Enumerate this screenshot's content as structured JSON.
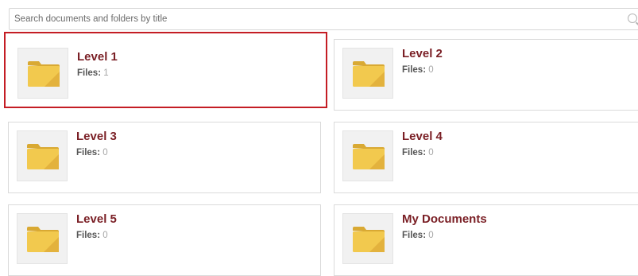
{
  "search": {
    "placeholder": "Search documents and folders by title"
  },
  "folders": [
    {
      "title": "Level 1",
      "files_label": "Files:",
      "files_count": "1",
      "selected": true
    },
    {
      "title": "Level 2",
      "files_label": "Files:",
      "files_count": "0",
      "selected": false
    },
    {
      "title": "Level 3",
      "files_label": "Files:",
      "files_count": "0",
      "selected": false
    },
    {
      "title": "Level 4",
      "files_label": "Files:",
      "files_count": "0",
      "selected": false
    },
    {
      "title": "Level 5",
      "files_label": "Files:",
      "files_count": "0",
      "selected": false
    },
    {
      "title": "My Documents",
      "files_label": "Files:",
      "files_count": "0",
      "selected": false
    }
  ],
  "icons": {
    "search": "search-icon",
    "folder": "folder-icon"
  },
  "colors": {
    "title": "#7a1f25",
    "selection_border": "#c41d24",
    "folder_yellow": "#f0c84c"
  }
}
